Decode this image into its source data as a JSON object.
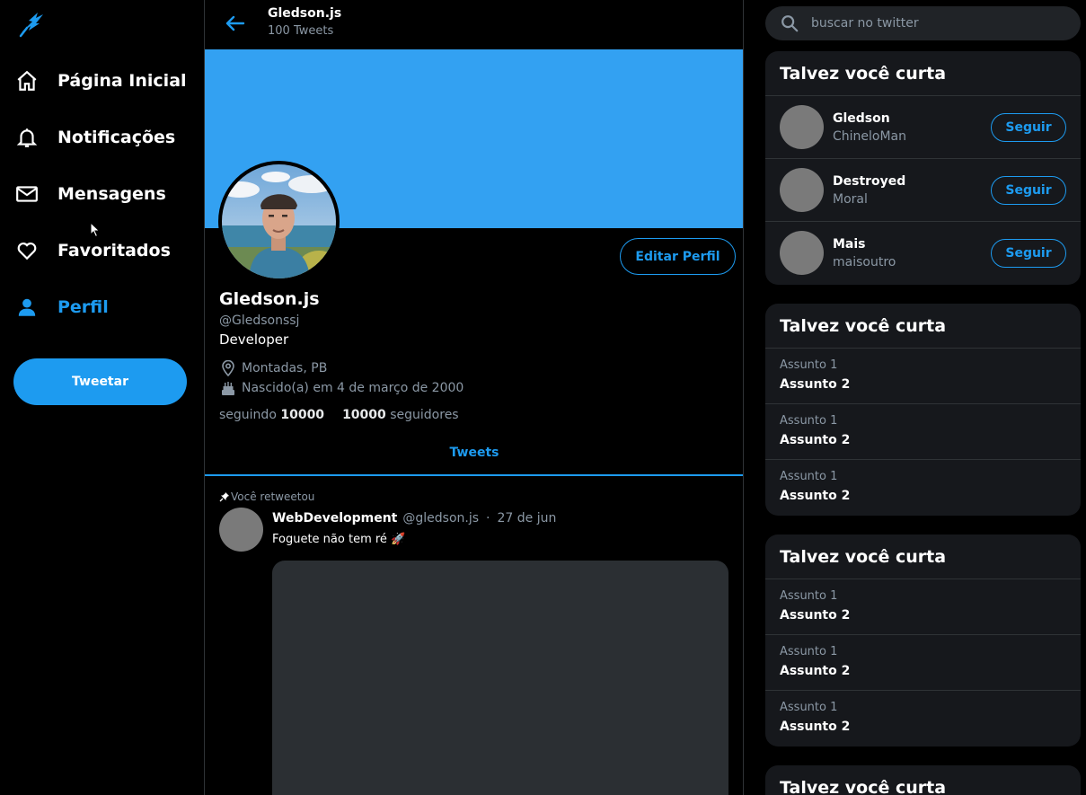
{
  "nav": {
    "items": [
      {
        "label": "Página Inicial",
        "icon": "home-icon"
      },
      {
        "label": "Notificações",
        "icon": "bell-icon"
      },
      {
        "label": "Mensagens",
        "icon": "mail-icon"
      },
      {
        "label": "Favoritados",
        "icon": "heart-icon"
      },
      {
        "label": "Perfil",
        "icon": "user-icon",
        "active": true
      }
    ],
    "tweet_button": "Tweetar"
  },
  "header": {
    "name": "Gledson.js",
    "tweet_count": "100 Tweets"
  },
  "profile": {
    "name": "Gledson.js",
    "handle": "@Gledsonssj",
    "bio": "Developer",
    "location": "Montadas, PB",
    "birth": "Nascido(a) em 4 de março de 2000",
    "following_label": "seguindo",
    "following_count": "10000",
    "followers_count": "10000",
    "followers_label": "seguidores",
    "edit_button": "Editar Perfil",
    "banner_color": "#33a1f2"
  },
  "tabs": {
    "active": "Tweets"
  },
  "tweet": {
    "retweet_label": "Você retweetou",
    "author": "WebDevelopment",
    "handle": "@gledson.js",
    "separator": "·",
    "date": "27 de jun",
    "text": "Foguete não tem ré 🚀"
  },
  "right": {
    "search_placeholder": "buscar no twitter",
    "follow_panel": {
      "title": "Talvez você curta",
      "button_label": "Seguir",
      "users": [
        {
          "name": "Gledson",
          "handle": "ChineloMan"
        },
        {
          "name": "Destroyed",
          "handle": "Moral"
        },
        {
          "name": "Mais",
          "handle": "maisoutro"
        }
      ]
    },
    "topic_panels": [
      {
        "title": "Talvez você curta",
        "topics": [
          {
            "line1": "Assunto 1",
            "line2": "Assunto 2"
          },
          {
            "line1": "Assunto 1",
            "line2": "Assunto 2"
          },
          {
            "line1": "Assunto 1",
            "line2": "Assunto 2"
          }
        ]
      },
      {
        "title": "Talvez você curta",
        "topics": [
          {
            "line1": "Assunto 1",
            "line2": "Assunto 2"
          },
          {
            "line1": "Assunto 1",
            "line2": "Assunto 2"
          },
          {
            "line1": "Assunto 1",
            "line2": "Assunto 2"
          }
        ]
      },
      {
        "title": "Talvez você curta",
        "topics": []
      }
    ]
  },
  "colors": {
    "accent": "#1d9bf0",
    "background": "#000000",
    "panel": "#16181c",
    "muted_text": "#8b98a5"
  }
}
